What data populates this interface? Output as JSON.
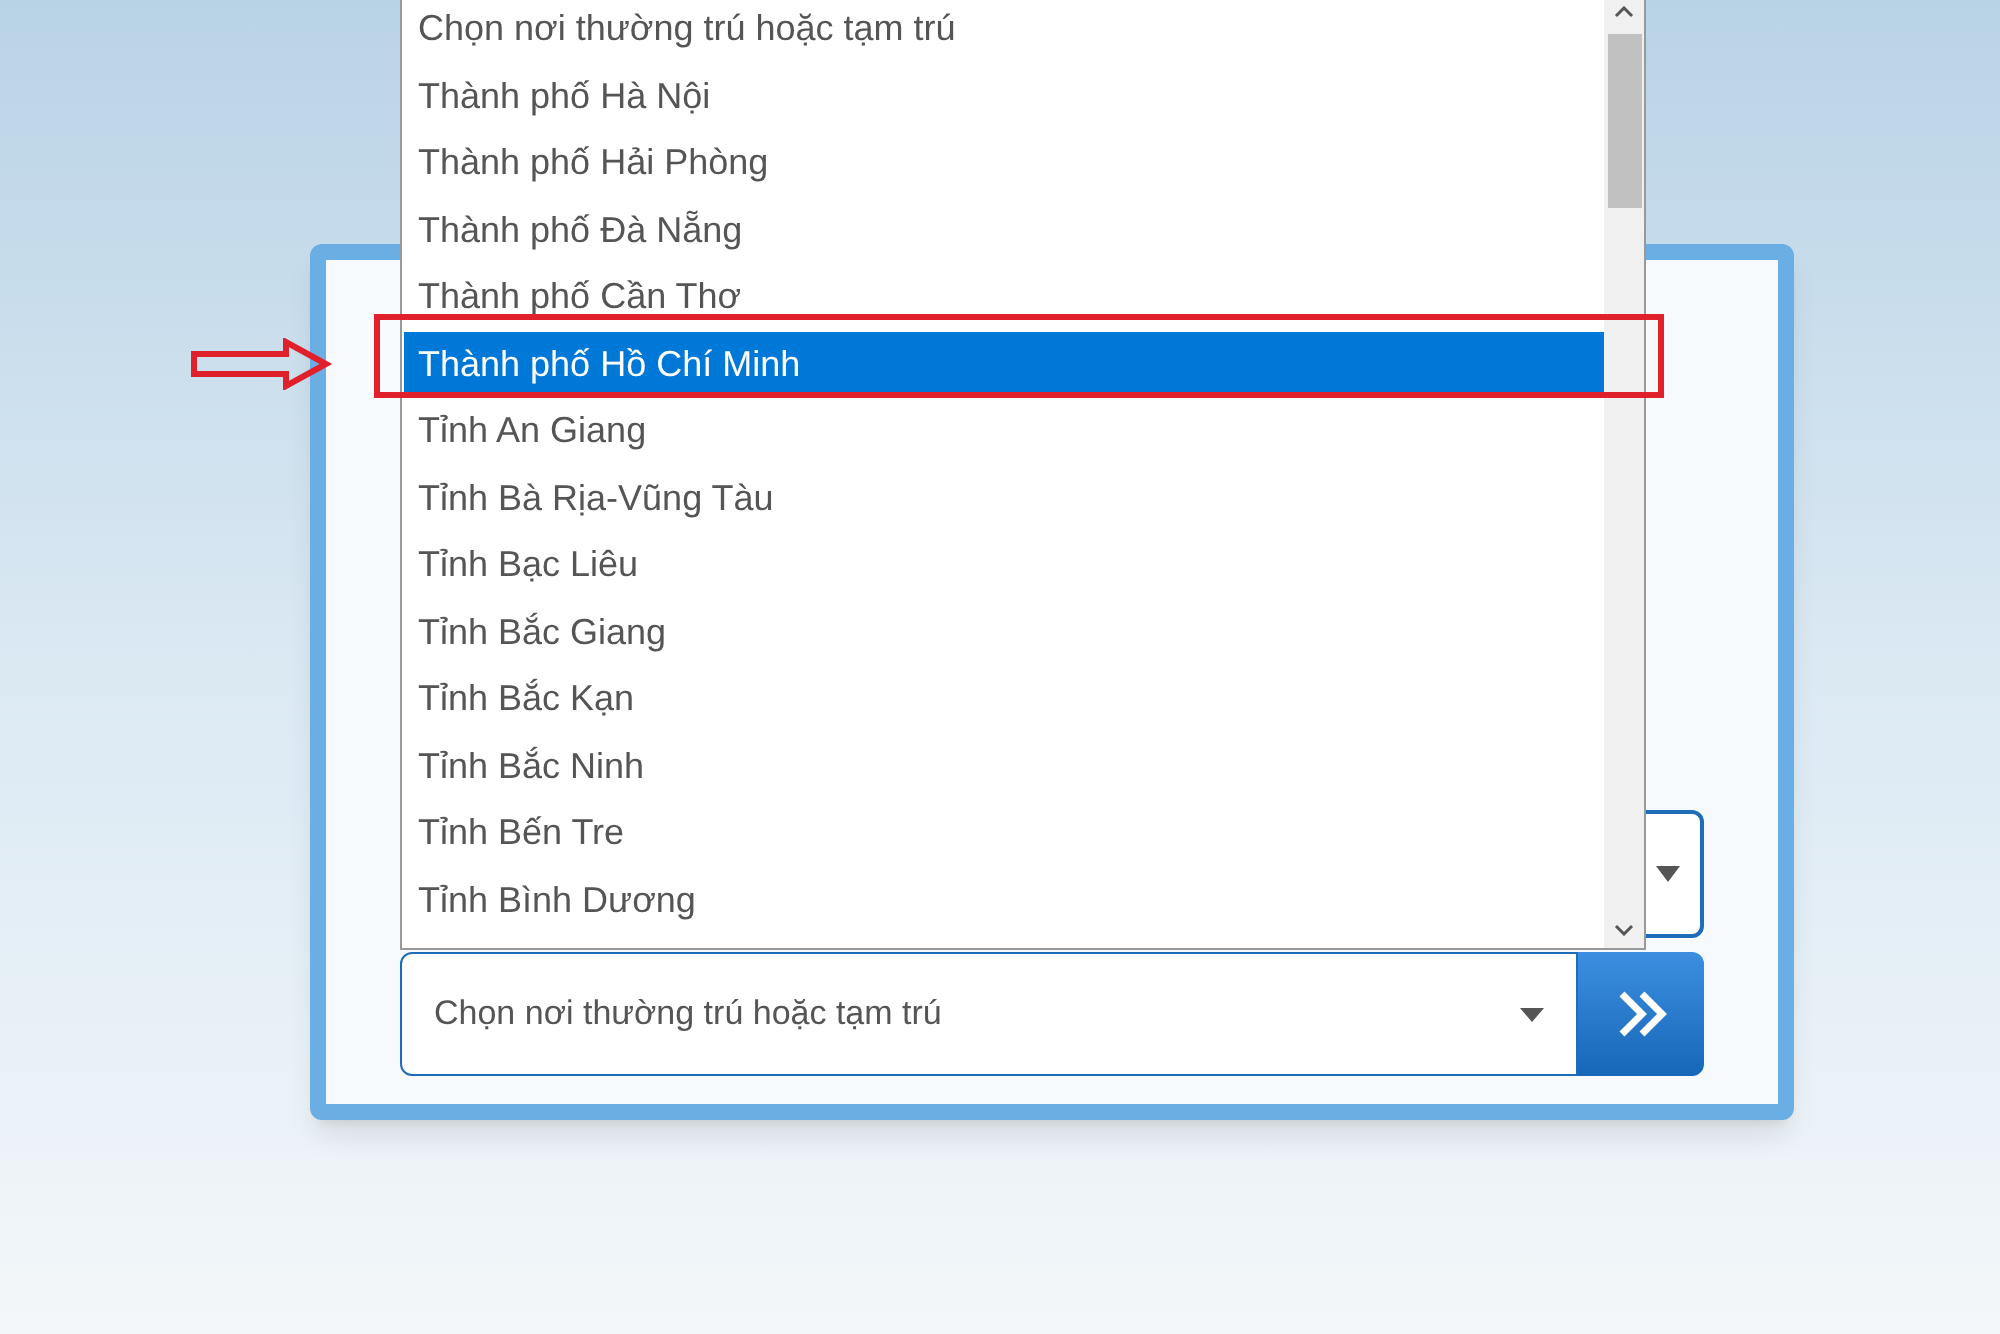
{
  "dropdown": {
    "options": [
      {
        "label": "Chọn nơi thường trú hoặc tạm trú",
        "selected": false
      },
      {
        "label": "Thành phố Hà Nội",
        "selected": false
      },
      {
        "label": "Thành phố Hải Phòng",
        "selected": false
      },
      {
        "label": "Thành phố Đà Nẵng",
        "selected": false
      },
      {
        "label": "Thành phố Cần Thơ",
        "selected": false
      },
      {
        "label": "Thành phố Hồ Chí Minh",
        "selected": true
      },
      {
        "label": "Tỉnh An Giang",
        "selected": false
      },
      {
        "label": "Tỉnh Bà Rịa-Vũng Tàu",
        "selected": false
      },
      {
        "label": "Tỉnh Bạc Liêu",
        "selected": false
      },
      {
        "label": "Tỉnh Bắc Giang",
        "selected": false
      },
      {
        "label": "Tỉnh Bắc Kạn",
        "selected": false
      },
      {
        "label": "Tỉnh Bắc Ninh",
        "selected": false
      },
      {
        "label": "Tỉnh Bến Tre",
        "selected": false
      },
      {
        "label": "Tỉnh Bình Dương",
        "selected": false
      }
    ]
  },
  "residence_select": {
    "placeholder": "Chọn nơi thường trú hoặc tạm trú"
  }
}
